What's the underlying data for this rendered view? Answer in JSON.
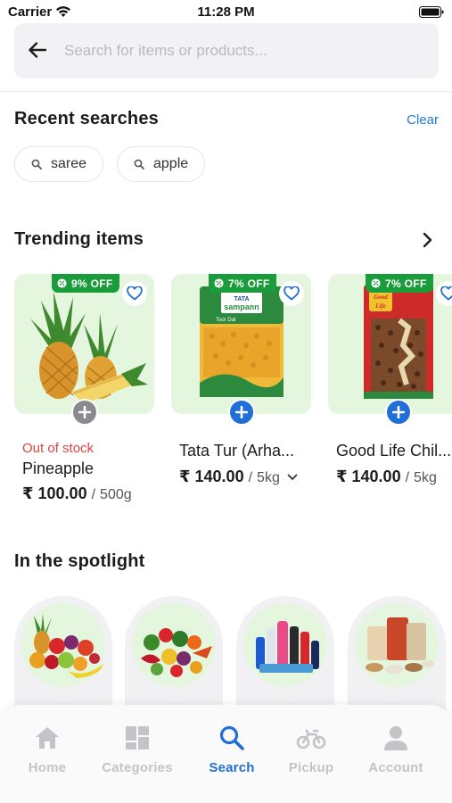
{
  "status_bar": {
    "carrier": "Carrier",
    "time": "11:28 PM"
  },
  "search": {
    "placeholder": "Search for items or products..."
  },
  "recent": {
    "title": "Recent searches",
    "clear_label": "Clear",
    "chips": [
      {
        "label": "saree"
      },
      {
        "label": "apple"
      }
    ]
  },
  "trending": {
    "title": "Trending items",
    "products": [
      {
        "discount": "9% OFF",
        "stock_status": "Out of stock",
        "name": "Pineapple",
        "price": "₹ 100.00",
        "quantity": "500g",
        "image": "pineapple"
      },
      {
        "discount": "7% OFF",
        "stock_status": "",
        "name": "Tata Tur (Arha...",
        "price": "₹ 140.00",
        "quantity": "5kg",
        "image": "tata-sampann-tur-dal-pack"
      },
      {
        "discount": "7% OFF",
        "stock_status": "",
        "name": "Good Life Chil...",
        "price": "₹ 140.00",
        "quantity": "5kg",
        "image": "good-life-chilli-pack"
      }
    ],
    "quantity_separator": "/",
    "pack_text": {
      "tata_brand_1": "TATA",
      "tata_brand_2": "sampann",
      "tata_product": "Toor Dal",
      "goodlife_brand_1": "Good",
      "goodlife_brand_2": "Life"
    }
  },
  "spotlight": {
    "title": "In the spotlight",
    "items": [
      {
        "image": "fruits"
      },
      {
        "image": "vegetables"
      },
      {
        "image": "personal-care"
      },
      {
        "image": "staples"
      }
    ]
  },
  "nav": {
    "items": [
      {
        "label": "Home",
        "icon": "home-icon",
        "active": false
      },
      {
        "label": "Categories",
        "icon": "categories-icon",
        "active": false
      },
      {
        "label": "Search",
        "icon": "search-icon",
        "active": true
      },
      {
        "label": "Pickup",
        "icon": "scooter-icon",
        "active": false
      },
      {
        "label": "Account",
        "icon": "account-icon",
        "active": false
      }
    ]
  },
  "colors": {
    "accent": "#1f6fd6",
    "discount_green": "#1a9c3a",
    "out_of_stock": "#e14343",
    "card_bg": "#e5f6df"
  }
}
